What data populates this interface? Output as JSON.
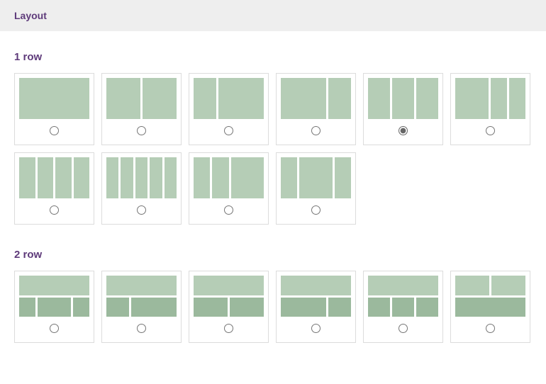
{
  "header": {
    "title": "Layout"
  },
  "sections": {
    "row1": {
      "title": "1 row"
    },
    "row2": {
      "title": "2 row"
    }
  },
  "row1_options": [
    {
      "id": "r1-1",
      "selected": false,
      "rows": [
        [
          100
        ]
      ]
    },
    {
      "id": "r1-2",
      "selected": false,
      "rows": [
        [
          50,
          50
        ]
      ]
    },
    {
      "id": "r1-3",
      "selected": false,
      "rows": [
        [
          33,
          67
        ]
      ]
    },
    {
      "id": "r1-4",
      "selected": false,
      "rows": [
        [
          67,
          33
        ]
      ]
    },
    {
      "id": "r1-5",
      "selected": true,
      "rows": [
        [
          33,
          33,
          33
        ]
      ]
    },
    {
      "id": "r1-6",
      "selected": false,
      "rows": [
        [
          50,
          25,
          25
        ]
      ]
    },
    {
      "id": "r1-7",
      "selected": false,
      "rows": [
        [
          25,
          25,
          25,
          25
        ]
      ]
    },
    {
      "id": "r1-8",
      "selected": false,
      "rows": [
        [
          20,
          20,
          20,
          20,
          20
        ]
      ]
    },
    {
      "id": "r1-9",
      "selected": false,
      "rows": [
        [
          25,
          25,
          50
        ]
      ]
    },
    {
      "id": "r1-10",
      "selected": false,
      "rows": [
        [
          25,
          50,
          25
        ]
      ]
    }
  ],
  "row2_options": [
    {
      "id": "r2-1",
      "selected": false,
      "rows": [
        [
          100
        ],
        [
          25,
          50,
          25
        ]
      ]
    },
    {
      "id": "r2-2",
      "selected": false,
      "rows": [
        [
          100
        ],
        [
          33,
          67
        ]
      ]
    },
    {
      "id": "r2-3",
      "selected": false,
      "rows": [
        [
          100
        ],
        [
          50,
          50
        ]
      ]
    },
    {
      "id": "r2-4",
      "selected": false,
      "rows": [
        [
          100
        ],
        [
          67,
          33
        ]
      ]
    },
    {
      "id": "r2-5",
      "selected": false,
      "rows": [
        [
          100
        ],
        [
          33,
          33,
          33
        ]
      ]
    },
    {
      "id": "r2-6",
      "selected": false,
      "rows": [
        [
          50,
          50
        ],
        [
          100
        ]
      ]
    }
  ]
}
